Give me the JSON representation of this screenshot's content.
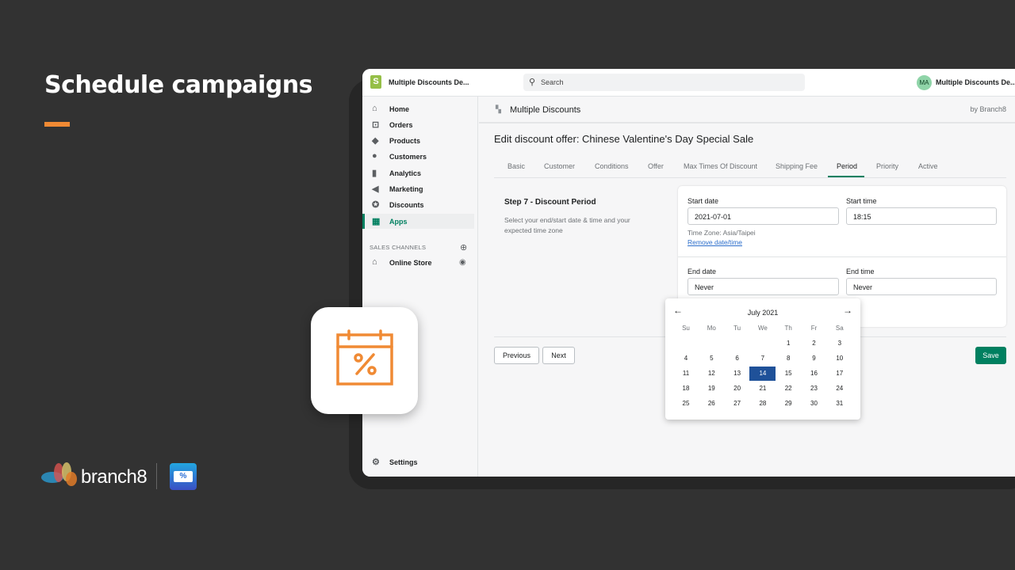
{
  "slide": {
    "title": "Schedule campaigns",
    "accent_color": "#f08a34",
    "brand_text": "branch8"
  },
  "topbar": {
    "store_name": "Multiple Discounts De...",
    "search_placeholder": "Search",
    "avatar_initials": "MA",
    "account_name": "Multiple Discounts De..."
  },
  "sidebar": {
    "items": [
      {
        "label": "Home",
        "icon": "home-icon"
      },
      {
        "label": "Orders",
        "icon": "orders-icon"
      },
      {
        "label": "Products",
        "icon": "tag-icon"
      },
      {
        "label": "Customers",
        "icon": "person-icon"
      },
      {
        "label": "Analytics",
        "icon": "bar-chart-icon"
      },
      {
        "label": "Marketing",
        "icon": "megaphone-icon"
      },
      {
        "label": "Discounts",
        "icon": "discount-icon"
      },
      {
        "label": "Apps",
        "icon": "apps-icon",
        "active": true
      }
    ],
    "sales_channels_label": "SALES CHANNELS",
    "online_store": "Online Store",
    "settings": "Settings"
  },
  "app": {
    "name": "Multiple Discounts",
    "by": "by Branch8"
  },
  "page": {
    "title": "Edit discount offer: Chinese Valentine's Day Special Sale",
    "tabs": [
      "Basic",
      "Customer",
      "Conditions",
      "Offer",
      "Max Times Of Discount",
      "Shipping Fee",
      "Period",
      "Priority",
      "Active"
    ],
    "active_tab": "Period",
    "step_title": "Step 7 - Discount Period",
    "step_desc": "Select your end/start date & time and your expected time zone",
    "start_date_label": "Start date",
    "start_date": "2021-07-01",
    "start_time_label": "Start time",
    "start_time": "18:15",
    "time_zone": "Time Zone: Asia/Taipei",
    "remove_link": "Remove date/time",
    "end_date_label": "End date",
    "end_date": "Never",
    "end_time_label": "End time",
    "end_time": "Never",
    "previous": "Previous",
    "next": "Next",
    "save": "Save"
  },
  "calendar": {
    "month": "July 2021",
    "weekdays": [
      "Su",
      "Mo",
      "Tu",
      "We",
      "Th",
      "Fr",
      "Sa"
    ],
    "first_weekday": 4,
    "days": 31,
    "selected": 14
  }
}
